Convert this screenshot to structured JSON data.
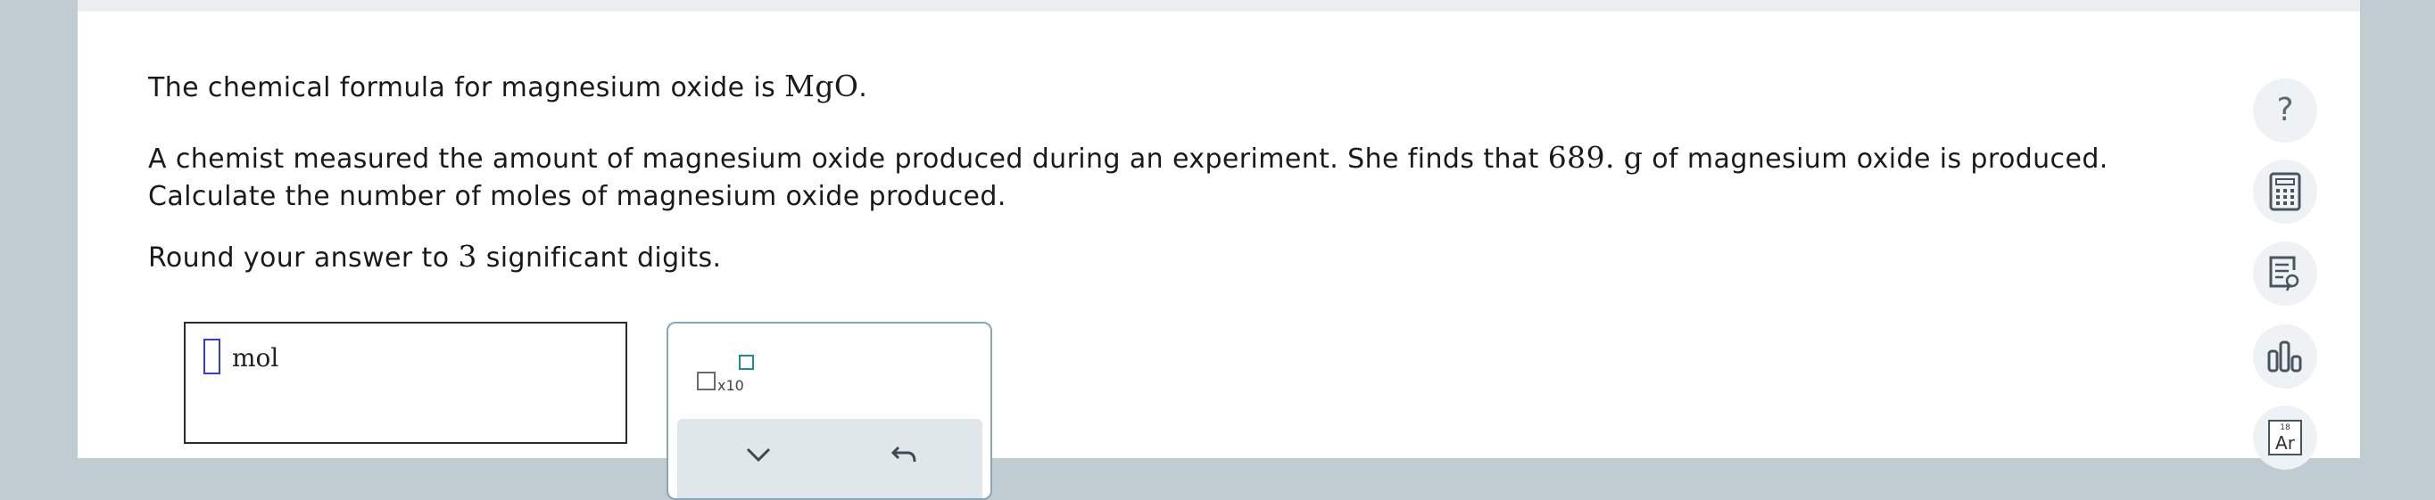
{
  "question": {
    "line1": {
      "text": "The chemical formula for magnesium oxide is ",
      "formula": "MgO",
      "suffix": "."
    },
    "line2": {
      "text_before": "A chemist measured the amount of magnesium oxide produced during an experiment. She finds that ",
      "mass_value": "689.",
      "mass_unit": "g",
      "text_after": " of magnesium oxide is produced. Calculate the number of moles of magnesium oxide produced."
    },
    "line3": {
      "text_before": "Round your answer to ",
      "digits": "3",
      "text_after": " significant digits."
    }
  },
  "answer": {
    "unit": "mol"
  },
  "tools": {
    "x10_label": "x10"
  },
  "sidebar": {
    "help_symbol": "?",
    "periodic": {
      "number": "18",
      "symbol": "Ar"
    }
  },
  "colors": {
    "page_bg": "#c0cbd2",
    "cursor": "#3a3ad6",
    "exponent_box": "#16928f",
    "tool_border": "#86a7b9",
    "tool_actions_bg": "#e0e7ea",
    "sidebar_btn_bg": "#eef2f4"
  },
  "icons": [
    "question-mark-icon",
    "calculator-icon",
    "notes-icon",
    "bar-chart-icon",
    "periodic-table-icon",
    "clear-x-icon",
    "undo-icon",
    "x10-icon"
  ]
}
